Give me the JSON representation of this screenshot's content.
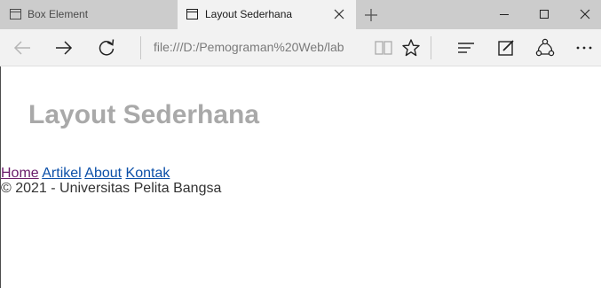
{
  "browser": {
    "tabs": [
      {
        "title": "Box Element",
        "active": false
      },
      {
        "title": "Layout Sederhana",
        "active": true
      }
    ],
    "address": "file:///D:/Pemograman%20Web/lab"
  },
  "page": {
    "header": "Layout Sederhana",
    "nav": [
      "Home",
      "Artikel",
      "About",
      "Kontak"
    ],
    "footer": "© 2021 - Universitas Pelita Bangsa"
  },
  "colors": {
    "header_text": "#a9a9a9",
    "link": "#0b4fa8",
    "visited_link": "#6a1b6a"
  }
}
